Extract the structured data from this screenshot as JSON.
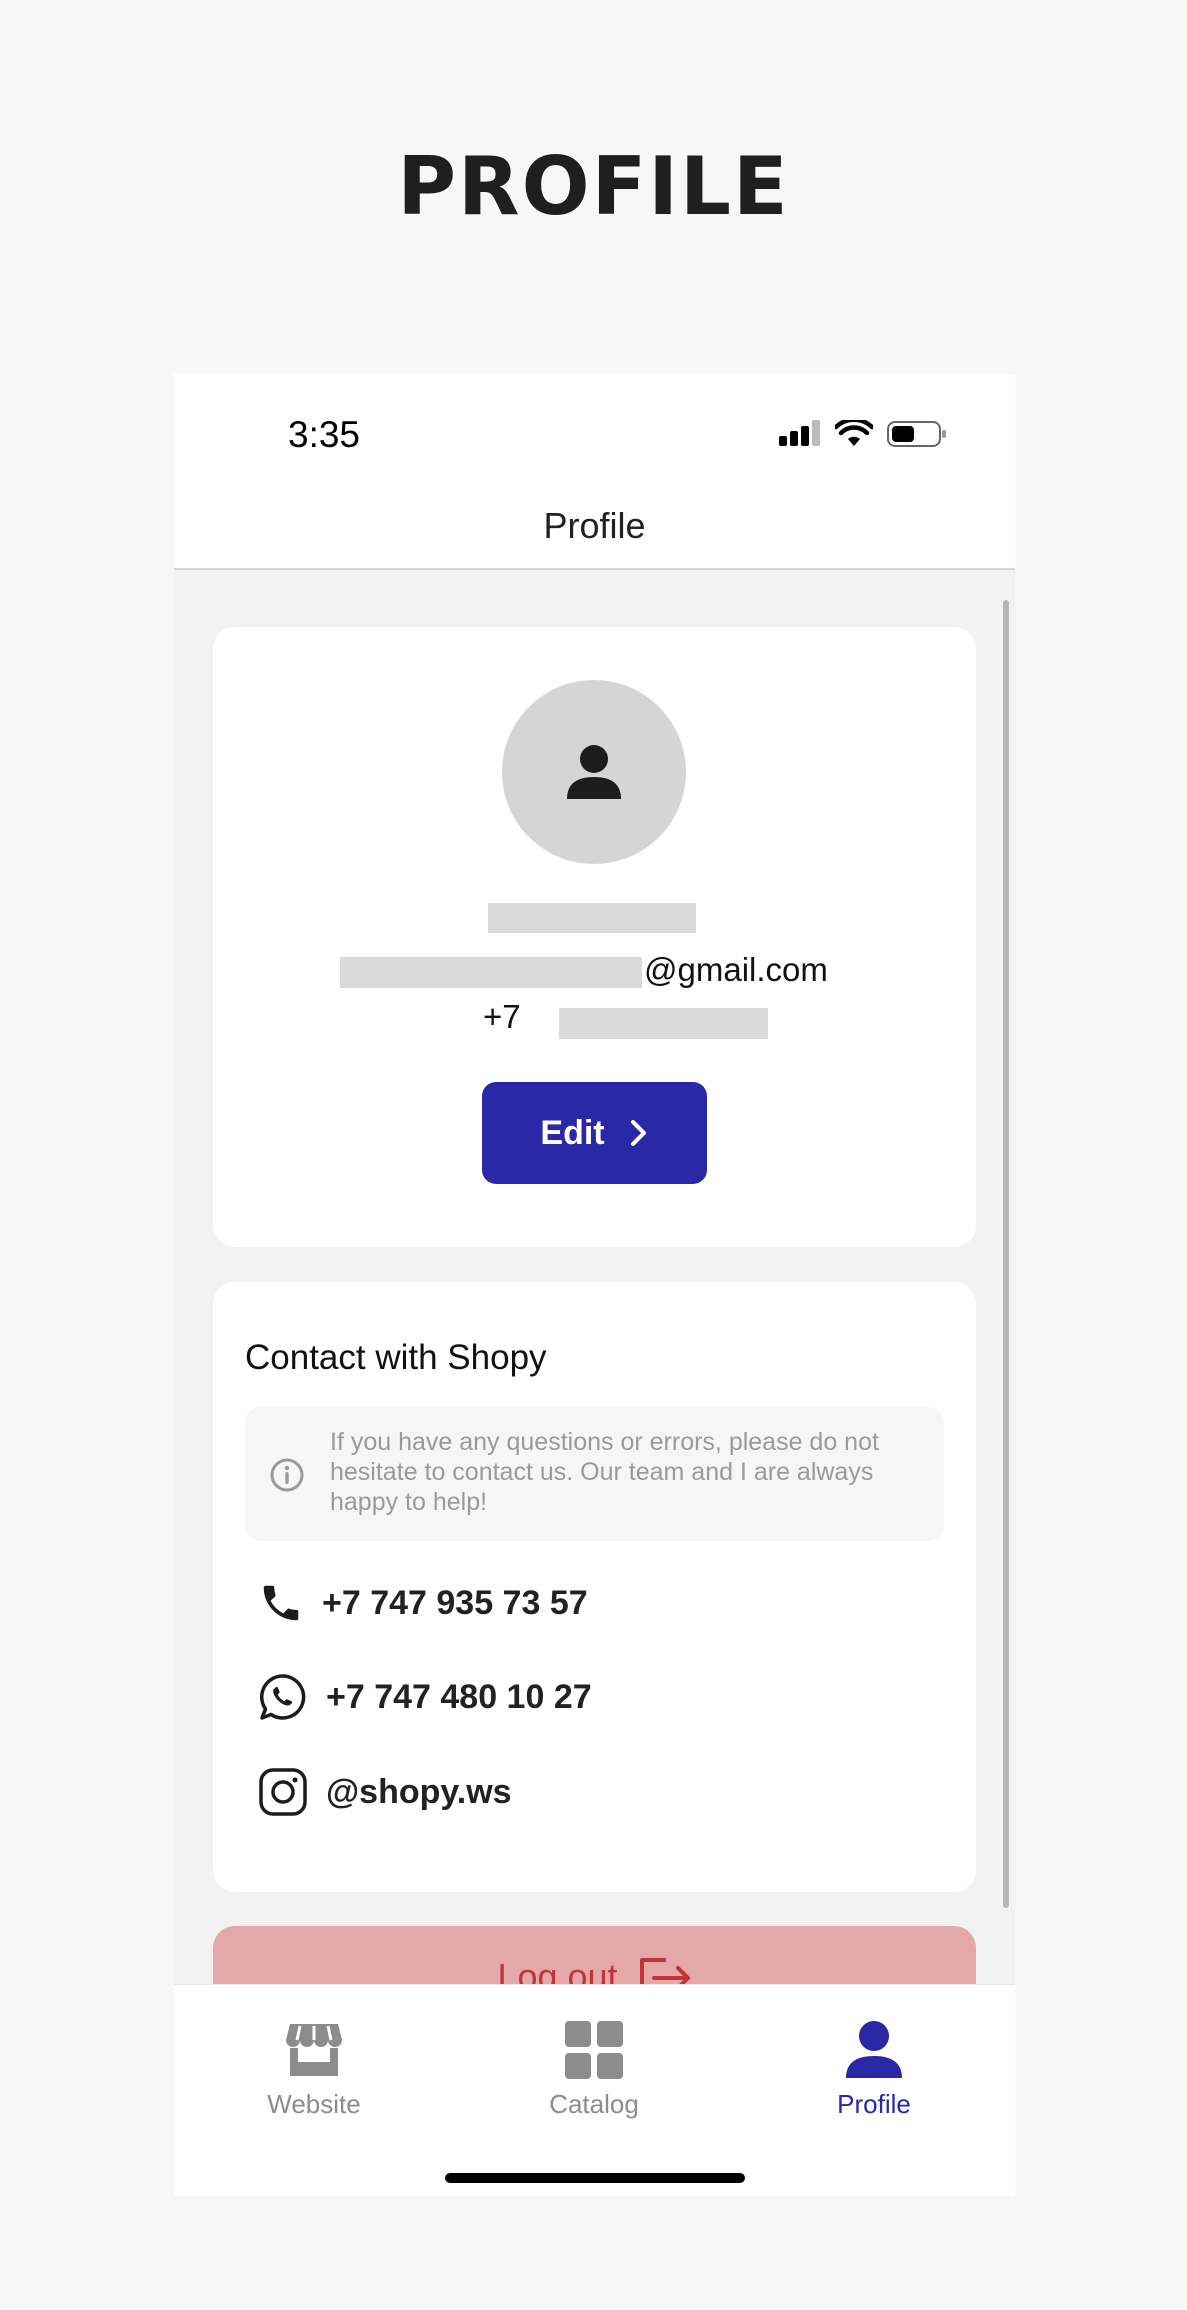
{
  "page": {
    "heading": "PROFILE"
  },
  "status_bar": {
    "time": "3:35"
  },
  "nav": {
    "title": "Profile"
  },
  "profile": {
    "email_suffix": "@gmail.com",
    "phone_prefix": "+7",
    "edit_label": "Edit"
  },
  "contact": {
    "title": "Contact with Shopy",
    "info": "If you have any questions or errors, please do not hesitate to contact us. Our team and I are always happy to help!",
    "phone": "+7 747 935 73 57",
    "whatsapp": "+7 747 480 10 27",
    "instagram": "@shopy.ws"
  },
  "logout": {
    "label": "Log out"
  },
  "tabs": [
    {
      "label": "Website",
      "icon": "store-icon"
    },
    {
      "label": "Catalog",
      "icon": "grid-icon"
    },
    {
      "label": "Profile",
      "icon": "user-icon",
      "active": true
    }
  ],
  "colors": {
    "accent": "#2a28a6",
    "logout_bg": "#e4a8a8",
    "logout_text": "#c2333a"
  }
}
